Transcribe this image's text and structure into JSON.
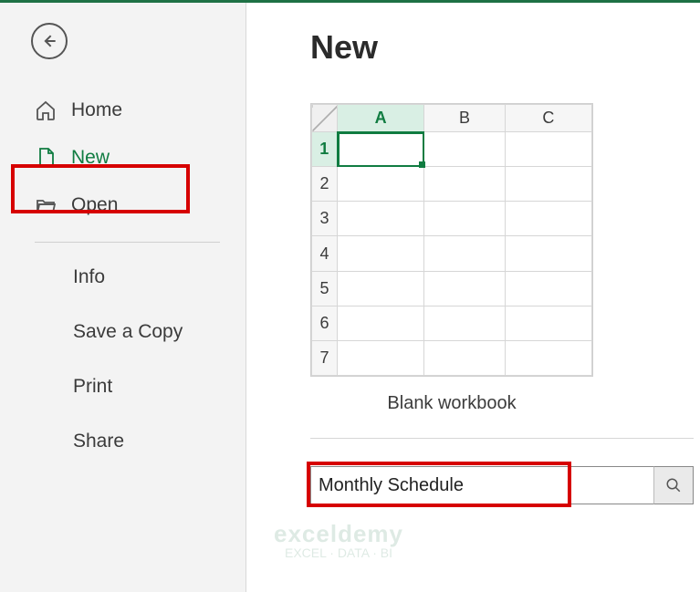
{
  "sidebar": {
    "home_label": "Home",
    "new_label": "New",
    "open_label": "Open",
    "info_label": "Info",
    "save_copy_label": "Save a Copy",
    "print_label": "Print",
    "share_label": "Share"
  },
  "main": {
    "title": "New",
    "template_label": "Blank workbook",
    "columns": [
      "A",
      "B",
      "C"
    ],
    "rows": [
      "1",
      "2",
      "3",
      "4",
      "5",
      "6",
      "7"
    ],
    "search_value": "Monthly Schedule"
  },
  "watermark": {
    "line1": "exceldemy",
    "line2": "EXCEL · DATA · BI"
  }
}
